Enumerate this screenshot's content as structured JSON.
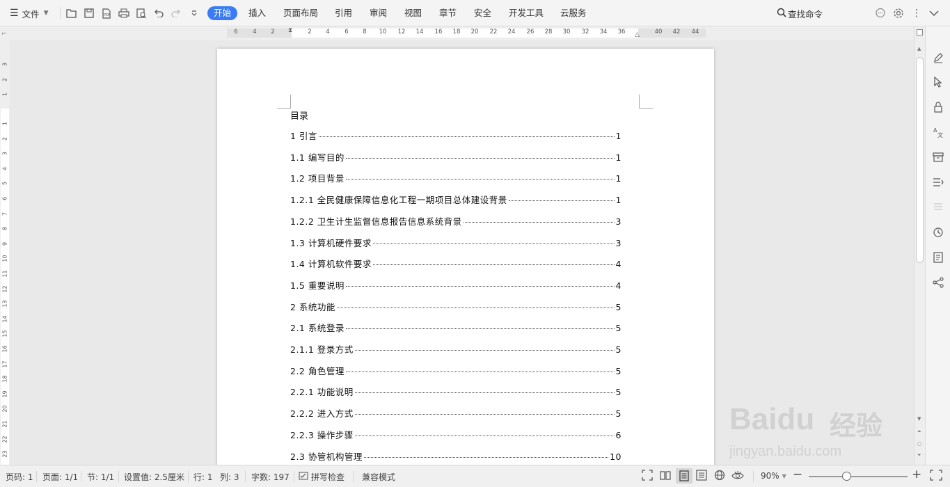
{
  "toolbar": {
    "file_menu": "文件",
    "tabs": [
      "开始",
      "插入",
      "页面布局",
      "引用",
      "审阅",
      "视图",
      "章节",
      "安全",
      "开发工具",
      "云服务"
    ],
    "search_label": "查找命令",
    "accent": "#3b7cf5"
  },
  "ruler": {
    "horizontal_ticks": [
      "6",
      "4",
      "2",
      "2",
      "4",
      "6",
      "8",
      "10",
      "12",
      "14",
      "16",
      "18",
      "20",
      "22",
      "24",
      "26",
      "28",
      "30",
      "32",
      "34",
      "36",
      "40",
      "42",
      "44"
    ],
    "vertical_ticks": [
      "3",
      "2",
      "1",
      "1",
      "2",
      "3",
      "4",
      "5",
      "6",
      "7",
      "8",
      "9",
      "10",
      "11",
      "12",
      "13",
      "14",
      "15",
      "16",
      "17",
      "18",
      "19",
      "20",
      "21",
      "22",
      "23"
    ]
  },
  "document": {
    "title": "目录",
    "toc": [
      {
        "text": "1 引言",
        "page": "1"
      },
      {
        "text": "1.1  编写目的",
        "page": "1"
      },
      {
        "text": "1.2 项目背景",
        "page": "1"
      },
      {
        "text": "1.2.1 全民健康保障信息化工程一期项目总体建设背景",
        "page": "1"
      },
      {
        "text": "1.2.2 卫生计生监督信息报告信息系统背景",
        "page": "3"
      },
      {
        "text": "1.3 计算机硬件要求",
        "page": "3"
      },
      {
        "text": "1.4 计算机软件要求",
        "page": "4"
      },
      {
        "text": "1.5 重要说明",
        "page": "4"
      },
      {
        "text": "2  系统功能",
        "page": "5"
      },
      {
        "text": "2.1  系统登录",
        "page": "5"
      },
      {
        "text": "2.1.1 登录方式",
        "page": "5"
      },
      {
        "text": "2.2 角色管理",
        "page": "5"
      },
      {
        "text": "2.2.1 功能说明",
        "page": "5"
      },
      {
        "text": "2.2.2 进入方式",
        "page": "5"
      },
      {
        "text": "2.2.3 操作步骤",
        "page": "6"
      },
      {
        "text": "2.3 协管机构管理",
        "page": "10"
      }
    ]
  },
  "status": {
    "page_code": "页码: 1",
    "pages": "页面: 1/1",
    "section": "节: 1/1",
    "setting": "设置值: 2.5厘米",
    "row": "行: 1",
    "col": "列: 3",
    "word_count": "字数: 197",
    "spell_check": "拼写检查",
    "compat_mode": "兼容模式",
    "zoom": "90%",
    "zoom_fraction": 0.38
  },
  "watermark": {
    "brand": "Baidu",
    "cn": "经验",
    "url": "jingyan.baidu.com"
  }
}
